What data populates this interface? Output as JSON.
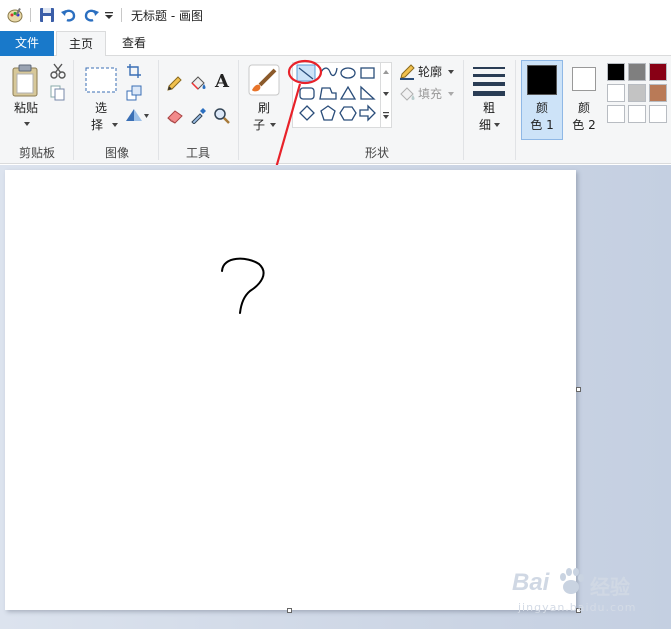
{
  "window": {
    "title": "无标题 - 画图"
  },
  "tabs": [
    {
      "label": "文件"
    },
    {
      "label": "主页"
    },
    {
      "label": "查看"
    }
  ],
  "ribbon": {
    "clipboard": {
      "paste_label": "粘贴",
      "group_label": "剪贴板"
    },
    "image": {
      "select_label_1": "选",
      "select_label_2": "择",
      "group_label": "图像"
    },
    "tools": {
      "group_label": "工具",
      "text_icon": "A"
    },
    "brushes": {
      "label_1": "刷",
      "label_2": "子"
    },
    "shapes": {
      "outline_label": "轮廓",
      "fill_label": "填充",
      "group_label": "形状"
    },
    "size": {
      "label_1": "粗",
      "label_2": "细"
    },
    "color1": {
      "label_1": "颜",
      "label_2": "色 1",
      "swatch": "#000000"
    },
    "color2": {
      "label_1": "颜",
      "label_2": "色 2",
      "swatch": "#ffffff"
    },
    "palette": [
      "#000000",
      "#7f7f7f",
      "#880015",
      "#ffffff",
      "#c3c3c3",
      "#b97a57",
      "#ffffff",
      "#ffffff",
      "#ffffff"
    ]
  },
  "colors": {
    "accent": "#1979ca",
    "annotation": "#e8222a"
  },
  "watermark": {
    "brand": "Bai",
    "brand2": "经验",
    "url": "jingyan.baidu.com"
  }
}
